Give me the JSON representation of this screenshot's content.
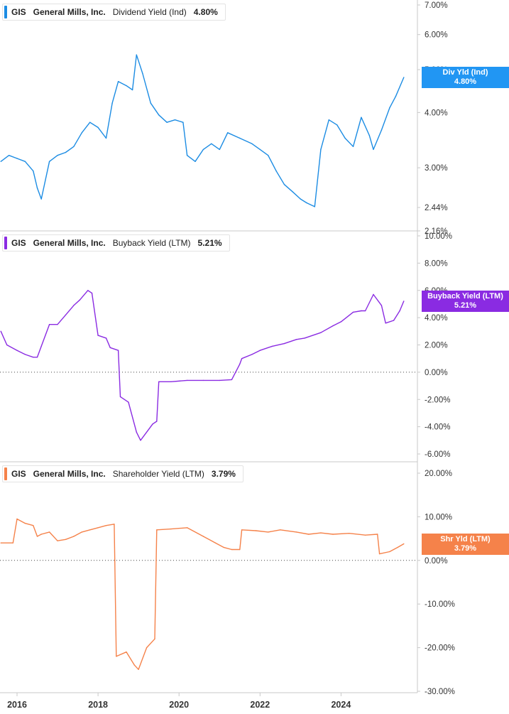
{
  "legends": [
    {
      "ticker": "GIS",
      "company": "General Mills, Inc.",
      "metric": "Dividend Yield (Ind)",
      "value": "4.80%",
      "color": "#1c8ce3"
    },
    {
      "ticker": "GIS",
      "company": "General Mills, Inc.",
      "metric": "Buyback Yield (LTM)",
      "value": "5.21%",
      "color": "#8a2be2"
    },
    {
      "ticker": "GIS",
      "company": "General Mills, Inc.",
      "metric": "Shareholder Yield (LTM)",
      "value": "3.79%",
      "color": "#f5824a"
    }
  ],
  "flags": [
    {
      "label": "Div Yld (Ind)",
      "value": "4.80%",
      "color": "#2196f3"
    },
    {
      "label": "Buyback Yield (LTM)",
      "value": "5.21%",
      "color": "#8a2be2"
    },
    {
      "label": "Shr Yld (LTM)",
      "value": "3.79%",
      "color": "#f5824a"
    }
  ],
  "chart_data": [
    {
      "type": "line",
      "title": "GIS General Mills, Inc. Dividend Yield (Ind) 4.80%",
      "scale": "log",
      "ylim": [
        2.16,
        7.0
      ],
      "yticks": [
        "7.00%",
        "6.00%",
        "5.00%",
        "4.00%",
        "3.00%",
        "2.44%",
        "2.16%"
      ],
      "ytick_values": [
        7.0,
        6.0,
        5.0,
        4.0,
        3.0,
        2.44,
        2.16
      ],
      "series": [
        {
          "name": "Div Yld (Ind)",
          "color": "#1c8ce3",
          "x": [
            2015.6,
            2015.8,
            2016.0,
            2016.2,
            2016.4,
            2016.5,
            2016.6,
            2016.8,
            2017.0,
            2017.2,
            2017.4,
            2017.6,
            2017.8,
            2018.0,
            2018.2,
            2018.35,
            2018.5,
            2018.7,
            2018.85,
            2018.95,
            2019.1,
            2019.3,
            2019.5,
            2019.7,
            2019.9,
            2020.1,
            2020.2,
            2020.4,
            2020.6,
            2020.8,
            2021.0,
            2021.2,
            2021.5,
            2021.8,
            2022.0,
            2022.2,
            2022.4,
            2022.6,
            2022.8,
            2023.0,
            2023.15,
            2023.35,
            2023.5,
            2023.7,
            2023.9,
            2024.1,
            2024.3,
            2024.5,
            2024.7,
            2024.8,
            2025.0,
            2025.2,
            2025.35,
            2025.55
          ],
          "values": [
            3.1,
            3.2,
            3.15,
            3.1,
            2.95,
            2.7,
            2.55,
            3.1,
            3.2,
            3.25,
            3.35,
            3.6,
            3.8,
            3.7,
            3.5,
            4.2,
            4.7,
            4.6,
            4.5,
            5.4,
            4.9,
            4.2,
            3.95,
            3.8,
            3.85,
            3.8,
            3.2,
            3.1,
            3.3,
            3.4,
            3.3,
            3.6,
            3.5,
            3.4,
            3.3,
            3.2,
            2.95,
            2.75,
            2.65,
            2.55,
            2.5,
            2.45,
            3.3,
            3.85,
            3.75,
            3.5,
            3.35,
            3.9,
            3.55,
            3.3,
            3.65,
            4.1,
            4.35,
            4.8
          ]
        }
      ]
    },
    {
      "type": "line",
      "title": "GIS General Mills, Inc. Buyback Yield (LTM) 5.21%",
      "ylim": [
        -6.0,
        10.0
      ],
      "yticks": [
        "10.00%",
        "8.00%",
        "6.00%",
        "4.00%",
        "2.00%",
        "0.00%",
        "-2.00%",
        "-4.00%",
        "-6.00%"
      ],
      "ytick_values": [
        10,
        8,
        6,
        4,
        2,
        0,
        -2,
        -4,
        -6
      ],
      "series": [
        {
          "name": "Buyback Yield (LTM)",
          "color": "#8a2be2",
          "x": [
            2015.6,
            2015.75,
            2016.0,
            2016.2,
            2016.4,
            2016.5,
            2016.6,
            2016.8,
            2017.0,
            2017.2,
            2017.4,
            2017.55,
            2017.75,
            2017.85,
            2018.0,
            2018.2,
            2018.3,
            2018.5,
            2018.55,
            2018.75,
            2018.95,
            2019.05,
            2019.35,
            2019.45,
            2019.5,
            2019.8,
            2020.2,
            2020.6,
            2021.0,
            2021.3,
            2021.5,
            2021.55,
            2021.8,
            2022.0,
            2022.3,
            2022.6,
            2022.9,
            2023.1,
            2023.5,
            2023.8,
            2024.0,
            2024.3,
            2024.5,
            2024.6,
            2024.8,
            2025.0,
            2025.1,
            2025.3,
            2025.45,
            2025.55
          ],
          "values": [
            3.0,
            2.0,
            1.6,
            1.3,
            1.1,
            1.1,
            1.9,
            3.5,
            3.5,
            4.2,
            4.9,
            5.3,
            6.0,
            5.8,
            2.7,
            2.5,
            1.8,
            1.6,
            -1.8,
            -2.2,
            -4.4,
            -5.0,
            -3.8,
            -3.6,
            -0.7,
            -0.7,
            -0.6,
            -0.6,
            -0.6,
            -0.55,
            0.6,
            1.0,
            1.3,
            1.6,
            1.9,
            2.1,
            2.4,
            2.5,
            2.9,
            3.4,
            3.7,
            4.4,
            4.5,
            4.5,
            5.7,
            4.9,
            3.6,
            3.8,
            4.5,
            5.21
          ]
        }
      ]
    },
    {
      "type": "line",
      "title": "GIS General Mills, Inc. Shareholder Yield (LTM) 3.79%",
      "ylim": [
        -30.0,
        20.0
      ],
      "yticks": [
        "20.00%",
        "10.00%",
        "0.00%",
        "-10.00%",
        "-20.00%",
        "-30.00%"
      ],
      "ytick_values": [
        20,
        10,
        0,
        -10,
        -20,
        -30
      ],
      "xlabel_ticks": [
        "2016",
        "2018",
        "2020",
        "2022",
        "2024"
      ],
      "x_ticks": [
        2016,
        2018,
        2020,
        2022,
        2024
      ],
      "series": [
        {
          "name": "Shr Yld (LTM)",
          "color": "#f5824a",
          "x": [
            2015.6,
            2015.9,
            2016.0,
            2016.2,
            2016.4,
            2016.5,
            2016.6,
            2016.8,
            2017.0,
            2017.2,
            2017.4,
            2017.6,
            2017.8,
            2018.0,
            2018.2,
            2018.4,
            2018.45,
            2018.7,
            2018.9,
            2019.0,
            2019.2,
            2019.4,
            2019.45,
            2019.8,
            2020.2,
            2020.6,
            2020.9,
            2021.1,
            2021.3,
            2021.5,
            2021.55,
            2021.9,
            2022.2,
            2022.5,
            2022.9,
            2023.2,
            2023.5,
            2023.8,
            2024.2,
            2024.6,
            2024.9,
            2024.95,
            2025.2,
            2025.4,
            2025.55
          ],
          "values": [
            4.0,
            4.0,
            9.5,
            8.5,
            8.0,
            5.5,
            6.0,
            6.5,
            4.5,
            4.8,
            5.5,
            6.5,
            7.0,
            7.5,
            8.0,
            8.3,
            -22.0,
            -21.0,
            -24.0,
            -25.0,
            -20.0,
            -18.0,
            7.0,
            7.2,
            7.5,
            5.5,
            4.0,
            3.0,
            2.5,
            2.5,
            7.0,
            6.8,
            6.5,
            7.0,
            6.5,
            6.0,
            6.3,
            6.0,
            6.2,
            5.8,
            6.0,
            1.5,
            2.0,
            3.0,
            3.79
          ]
        }
      ]
    }
  ]
}
